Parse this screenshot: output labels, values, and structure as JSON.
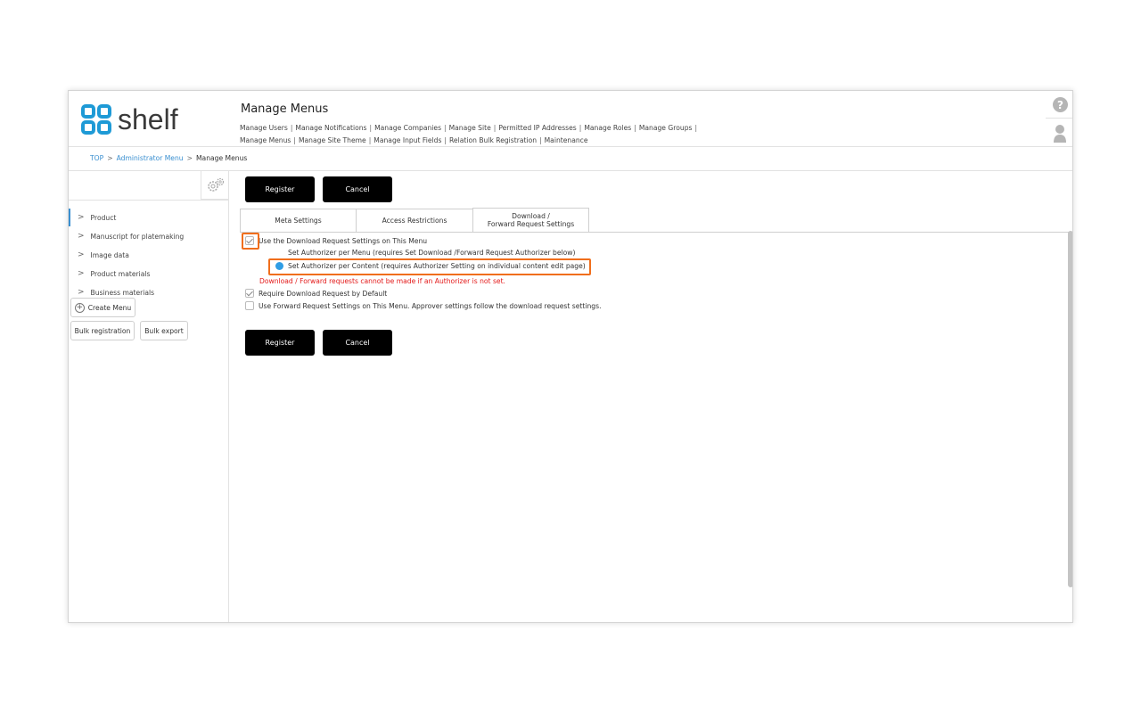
{
  "app": {
    "logo_text": "shelf"
  },
  "header": {
    "title": "Manage Menus",
    "nav": [
      "Manage Users",
      "Manage Notifications",
      "Manage Companies",
      "Manage Site",
      "Permitted IP Addresses",
      "Manage Roles",
      "Manage Groups",
      "Manage Menus",
      "Manage Site Theme",
      "Manage Input Fields",
      "Relation Bulk Registration",
      "Maintenance"
    ],
    "help_label": "?"
  },
  "breadcrumb": {
    "items": [
      "TOP",
      "Administrator Menu",
      "Manage Menus"
    ],
    "separator": ">"
  },
  "sidebar": {
    "items": [
      {
        "label": "Product"
      },
      {
        "label": "Manuscript for platemaking"
      },
      {
        "label": "Image data"
      },
      {
        "label": "Product materials"
      },
      {
        "label": "Business materials"
      }
    ],
    "create_menu_label": "Create Menu",
    "plus_glyph": "+",
    "bulk_registration_label": "Bulk registration",
    "bulk_export_label": "Bulk export",
    "chevron_glyph": ">"
  },
  "main": {
    "register_label": "Register",
    "cancel_label": "Cancel",
    "tabs": [
      {
        "label": "Meta Settings"
      },
      {
        "label": "Access Restrictions"
      },
      {
        "label_line1": "Download /",
        "label_line2": "Forward Request Settings"
      }
    ],
    "use_download_label": "Use the Download Request Settings on This Menu",
    "use_download_checked": true,
    "radio_per_menu_label": "Set Authorizer per Menu (requires Set Download /Forward Request Authorizer below)",
    "radio_per_content_label": "Set Authorizer per Content (requires Authorizer Setting on individual content edit page)",
    "selected_radio": "per_content",
    "warning_text": "Download / Forward requests cannot be made if an Authorizer is not set.",
    "require_default_label": "Require Download Request by Default",
    "require_default_checked": true,
    "use_forward_label": "Use Forward Request Settings on This Menu. Approver settings follow the download request settings.",
    "use_forward_checked": false
  },
  "colors": {
    "accent": "#3a8fd0",
    "highlight": "#f06e1c",
    "warning": "#e31818",
    "radio_on": "#2f9de5",
    "button": "#000000"
  }
}
